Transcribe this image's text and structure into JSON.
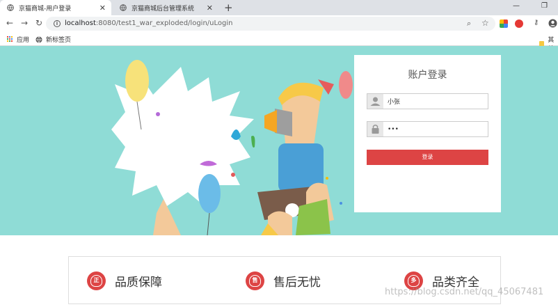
{
  "browser": {
    "tabs": [
      {
        "title": "京猫商城-用户登录",
        "close": "✕"
      },
      {
        "title": "京猫商城后台管理系统",
        "close": "✕"
      }
    ],
    "new_tab": "+",
    "url_host": "localhost",
    "url_rest": ":8080/test1_war_exploded/login/uLogin",
    "bookmarks": [
      {
        "label": "应用"
      },
      {
        "label": "新标签页"
      },
      {
        "label": "其他"
      }
    ]
  },
  "login": {
    "title": "账户登录",
    "username": "小张",
    "password": "•••",
    "submit": "登录"
  },
  "features": [
    {
      "badge": "正",
      "label": "品质保障"
    },
    {
      "badge": "售",
      "label": "售后无忧"
    },
    {
      "badge": "多",
      "label": "品类齐全"
    }
  ],
  "watermark": "https://blog.csdn.net/qq_45067481",
  "colors": {
    "banner": "#8fdcd6",
    "accent": "#dd4444"
  }
}
